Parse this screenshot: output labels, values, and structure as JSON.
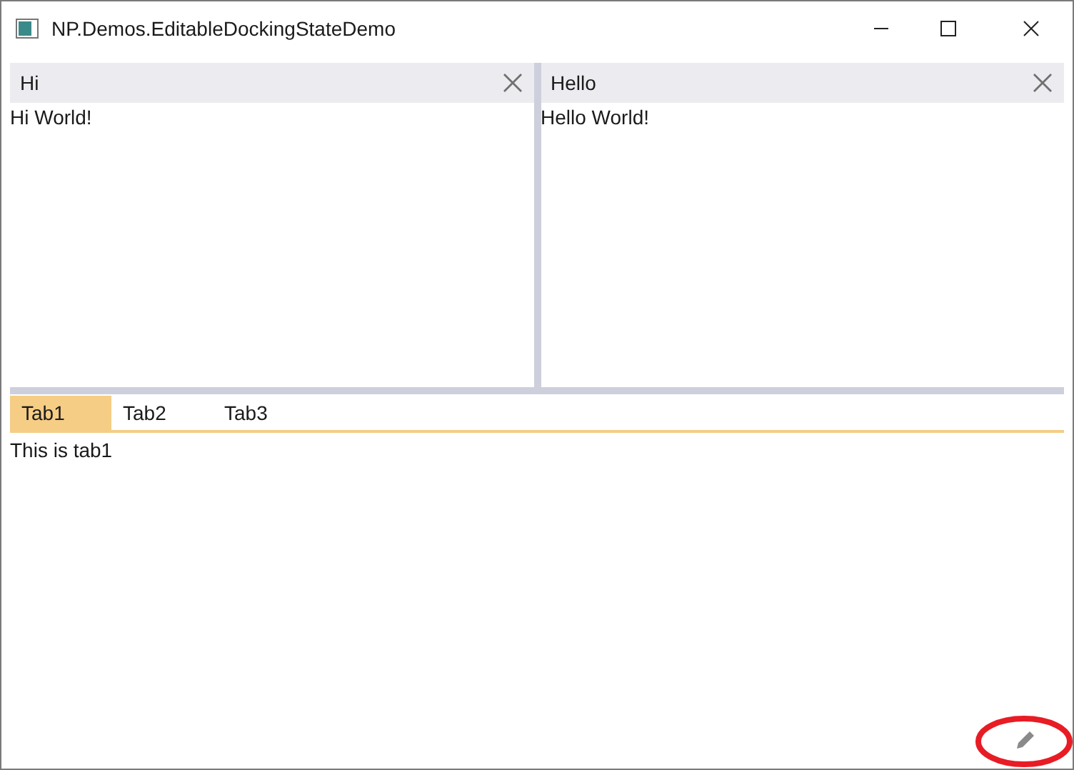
{
  "window": {
    "title": "NP.Demos.EditableDockingStateDemo"
  },
  "panes": [
    {
      "title": "Hi",
      "content": "Hi World!"
    },
    {
      "title": "Hello",
      "content": "Hello World!"
    }
  ],
  "tabs": [
    {
      "label": "Tab1",
      "selected": true
    },
    {
      "label": "Tab2",
      "selected": false
    },
    {
      "label": "Tab3",
      "selected": false
    }
  ],
  "tab_content": "This is tab1"
}
